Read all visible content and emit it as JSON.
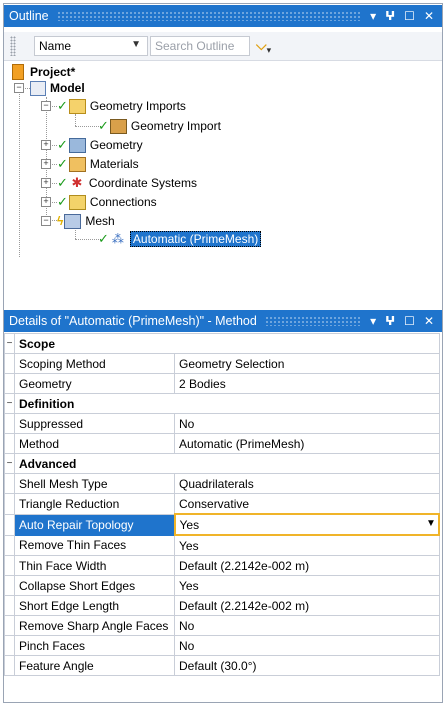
{
  "outline": {
    "title": "Outline",
    "controls": [
      "▾",
      "🞶",
      "☐",
      "✕"
    ],
    "name_select": "Name",
    "search_placeholder": "Search Outline",
    "tree": {
      "project": "Project*",
      "model": "Model",
      "geometry_imports": "Geometry Imports",
      "geometry_import": "Geometry Import",
      "geometry": "Geometry",
      "materials": "Materials",
      "coordinate_systems": "Coordinate Systems",
      "connections": "Connections",
      "mesh": "Mesh",
      "automatic": "Automatic (PrimeMesh)"
    }
  },
  "details": {
    "title": "Details of \"Automatic (PrimeMesh)\" - Method",
    "groups": {
      "scope": "Scope",
      "definition": "Definition",
      "advanced": "Advanced"
    },
    "rows": {
      "scoping_method": {
        "key": "Scoping Method",
        "value": "Geometry Selection"
      },
      "geometry": {
        "key": "Geometry",
        "value": "2 Bodies"
      },
      "suppressed": {
        "key": "Suppressed",
        "value": "No"
      },
      "method": {
        "key": "Method",
        "value": "Automatic (PrimeMesh)"
      },
      "shell_mesh_type": {
        "key": "Shell Mesh Type",
        "value": "Quadrilaterals"
      },
      "triangle_reduction": {
        "key": "Triangle Reduction",
        "value": "Conservative"
      },
      "auto_repair_topology": {
        "key": "Auto Repair Topology",
        "value": "Yes"
      },
      "remove_thin_faces": {
        "key": "Remove Thin Faces",
        "value": "Yes"
      },
      "thin_face_width": {
        "key": "Thin Face Width",
        "value": "Default (2.2142e-002 m)"
      },
      "collapse_short_edges": {
        "key": "Collapse Short Edges",
        "value": "Yes"
      },
      "short_edge_length": {
        "key": "Short Edge Length",
        "value": "Default (2.2142e-002 m)"
      },
      "remove_sharp_angle_faces": {
        "key": "Remove Sharp Angle Faces",
        "value": "No"
      },
      "pinch_faces": {
        "key": "Pinch Faces",
        "value": "No"
      },
      "feature_angle": {
        "key": "Feature Angle",
        "value": "Default (30.0°)"
      }
    }
  },
  "colors": {
    "titlebar": "#1f74cc",
    "selection": "#1f74cc",
    "focus_border": "#f0b429",
    "check": "#1a9a1a"
  }
}
